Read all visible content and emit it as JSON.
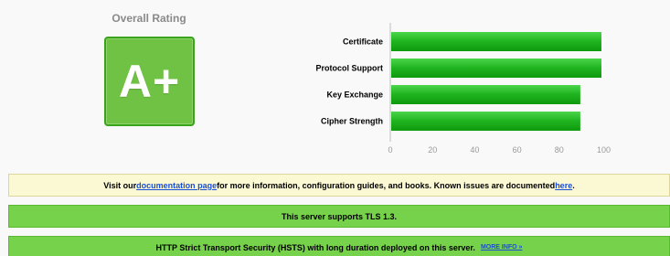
{
  "overall_rating": {
    "title": "Overall Rating",
    "grade": "A+"
  },
  "chart_data": {
    "type": "bar",
    "orientation": "horizontal",
    "categories": [
      "Certificate",
      "Protocol Support",
      "Key Exchange",
      "Cipher Strength"
    ],
    "values": [
      100,
      100,
      90,
      90
    ],
    "xlim": [
      0,
      100
    ],
    "xticks": [
      "0",
      "20",
      "40",
      "60",
      "80",
      "100"
    ],
    "bar_color": "#1fb31f",
    "grid": false
  },
  "banners": {
    "docs": {
      "text_before": "Visit our ",
      "link_text": "documentation page",
      "text_middle": " for more information, configuration guides, and books. Known issues are documented ",
      "link2_text": "here",
      "text_after": "."
    },
    "tls": {
      "text": "This server supports TLS 1.3."
    },
    "hsts": {
      "text": "HTTP Strict Transport Security (HSTS) with long duration deployed on this server.",
      "link_text": "MORE INFO »"
    }
  },
  "colors": {
    "grade_green": "#6fc244",
    "banner_green": "#76d24b",
    "banner_yellow": "#fbf8d4",
    "link_blue": "#1a4fd6"
  }
}
